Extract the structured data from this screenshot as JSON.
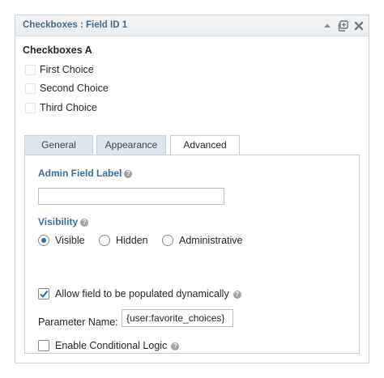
{
  "panel": {
    "title": "Checkboxes : Field ID 1",
    "header_icons": [
      "collapse-arrow-icon",
      "duplicate-icon",
      "delete-x-icon"
    ]
  },
  "field": {
    "label": "Checkboxes A",
    "choices": [
      {
        "label": "First Choice",
        "checked": false
      },
      {
        "label": "Second Choice",
        "checked": false
      },
      {
        "label": "Third Choice",
        "checked": false
      }
    ]
  },
  "tabs": [
    {
      "label": "General",
      "active": false
    },
    {
      "label": "Appearance",
      "active": false
    },
    {
      "label": "Advanced",
      "active": true
    }
  ],
  "advanced": {
    "admin_label": {
      "label": "Admin Field Label",
      "value": ""
    },
    "visibility": {
      "label": "Visibility",
      "options": [
        {
          "label": "Visible",
          "selected": true
        },
        {
          "label": "Hidden",
          "selected": false
        },
        {
          "label": "Administrative",
          "selected": false
        }
      ]
    },
    "dynamic": {
      "label": "Allow field to be populated dynamically",
      "checked": true
    },
    "parameter": {
      "label": "Parameter Name:",
      "value": "{user:favorite_choices}"
    },
    "conditional": {
      "label": "Enable Conditional Logic",
      "checked": false
    }
  },
  "colors": {
    "title": "#466a8b",
    "section_label": "#3a6d97",
    "tab_inactive": "#dde6ee",
    "accent": "#2271b1"
  }
}
